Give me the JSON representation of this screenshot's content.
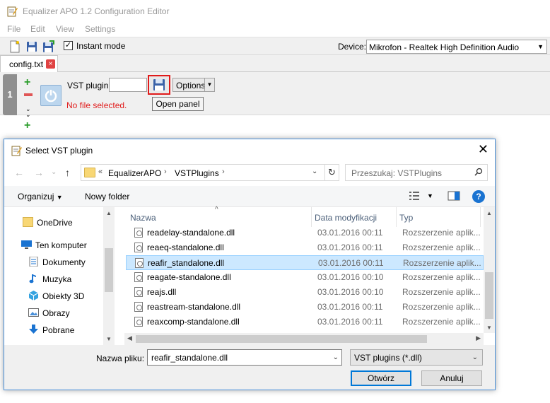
{
  "window": {
    "title": "Equalizer APO 1.2 Configuration Editor"
  },
  "menu": [
    "File",
    "Edit",
    "View",
    "Settings"
  ],
  "toolbar": {
    "instant_mode_label": "Instant mode",
    "device_label": "Device:",
    "device_value": "Mikrofon - Realtek High Definition Audio"
  },
  "tab": {
    "label": "config.txt",
    "close_glyph": "×"
  },
  "filter": {
    "row_number": "1",
    "vst_label": "VST plugin:",
    "vst_value": "",
    "options_label": "Options",
    "status": "No file selected.",
    "tooltip": "Open panel"
  },
  "dialog": {
    "title": "Select VST plugin",
    "breadcrumb": {
      "prefix": "«",
      "crumbs": [
        "EqualizerAPO",
        "VSTPlugins"
      ]
    },
    "search_placeholder": "Przeszukaj: VSTPlugins",
    "organize_label": "Organizuj",
    "new_folder_label": "Nowy folder",
    "help_glyph": "?",
    "nav_items": [
      "OneDrive",
      "Ten komputer",
      "Dokumenty",
      "Muzyka",
      "Obiekty 3D",
      "Obrazy",
      "Pobrane"
    ],
    "columns": {
      "name": "Nazwa",
      "date": "Data modyfikacji",
      "type": "Typ"
    },
    "files": [
      {
        "name": "readelay-standalone.dll",
        "date": "03.01.2016 00:11",
        "type": "Rozszerzenie aplik..."
      },
      {
        "name": "reaeq-standalone.dll",
        "date": "03.01.2016 00:11",
        "type": "Rozszerzenie aplik..."
      },
      {
        "name": "reafir_standalone.dll",
        "date": "03.01.2016 00:11",
        "type": "Rozszerzenie aplik..."
      },
      {
        "name": "reagate-standalone.dll",
        "date": "03.01.2016 00:10",
        "type": "Rozszerzenie aplik..."
      },
      {
        "name": "reajs.dll",
        "date": "03.01.2016 00:10",
        "type": "Rozszerzenie aplik..."
      },
      {
        "name": "reastream-standalone.dll",
        "date": "03.01.2016 00:11",
        "type": "Rozszerzenie aplik..."
      },
      {
        "name": "reaxcomp-standalone.dll",
        "date": "03.01.2016 00:11",
        "type": "Rozszerzenie aplik..."
      }
    ],
    "selected_index": 2,
    "filename_label": "Nazwa pliku:",
    "filename_value": "reafir_standalone.dll",
    "filetype_value": "VST plugins (*.dll)",
    "open_button": "Otwórz",
    "cancel_button": "Anuluj"
  },
  "colors": {
    "accent": "#0078d7",
    "selection": "#cce8ff",
    "error": "#e01b1b",
    "folder": "#f8d775"
  }
}
